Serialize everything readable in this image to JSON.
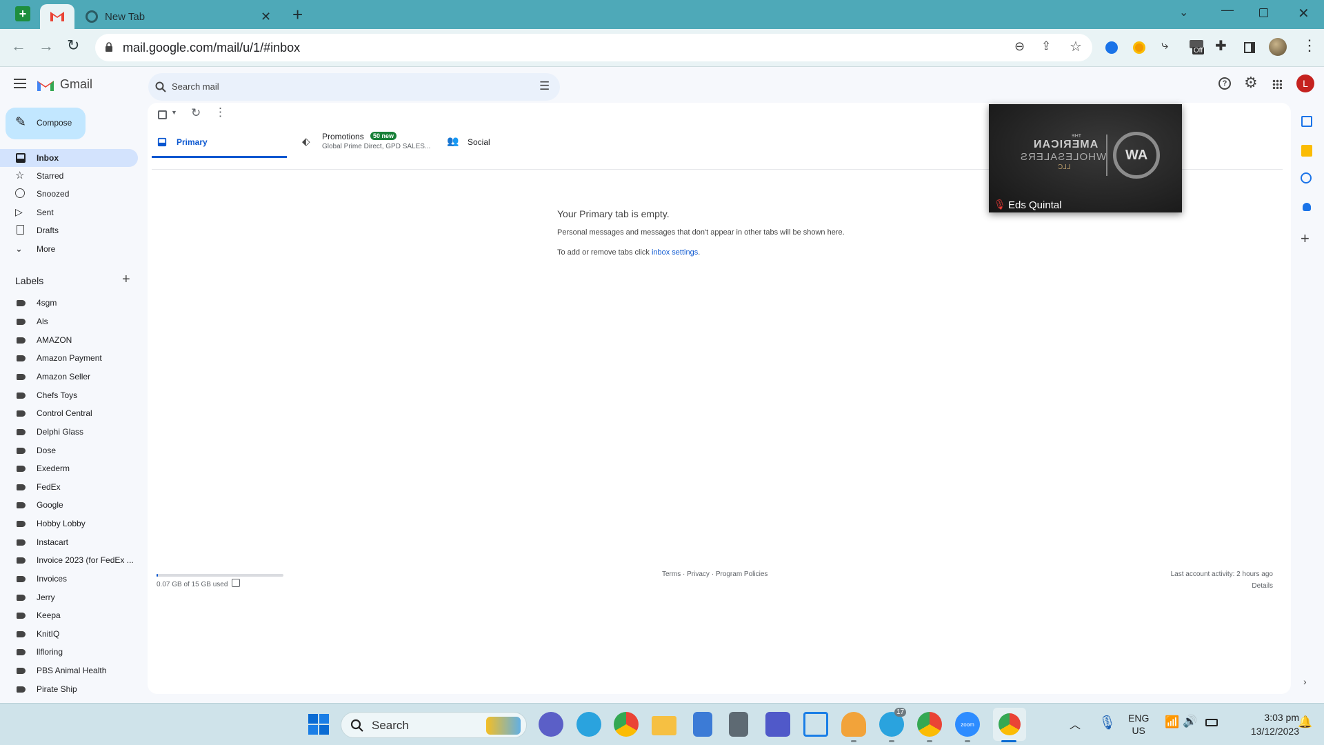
{
  "browser": {
    "tabs": [
      {
        "label": ""
      },
      {
        "label": "New Tab"
      }
    ],
    "url": "mail.google.com/mail/u/1/#inbox",
    "ext_badge": "Off"
  },
  "gmail": {
    "brand": "Gmail",
    "search_placeholder": "Search mail",
    "account_initial": "L",
    "compose": "Compose",
    "nav": [
      {
        "label": "Inbox",
        "icon": "inbox-icon"
      },
      {
        "label": "Starred",
        "icon": "star-icon"
      },
      {
        "label": "Snoozed",
        "icon": "clock-icon"
      },
      {
        "label": "Sent",
        "icon": "send-icon"
      },
      {
        "label": "Drafts",
        "icon": "draft-icon"
      },
      {
        "label": "More",
        "icon": "chevron-down-icon"
      }
    ],
    "labels_heading": "Labels",
    "labels": [
      "4sgm",
      "Als",
      "AMAZON",
      "Amazon Payment",
      "Amazon Seller",
      "Chefs Toys",
      "Control Central",
      "Delphi Glass",
      "Dose",
      "Exederm",
      "FedEx",
      "Google",
      "Hobby Lobby",
      "Instacart",
      "Invoice 2023 (for FedEx ...",
      "Invoices",
      "Jerry",
      "Keepa",
      "KnitIQ",
      "llfloring",
      "PBS Animal Health",
      "Pirate Ship"
    ],
    "tabs": {
      "primary": "Primary",
      "promotions": "Promotions",
      "promotions_badge": "50 new",
      "promotions_sub": "Global Prime Direct, GPD SALES...",
      "social": "Social"
    },
    "empty": {
      "title": "Your Primary tab is empty.",
      "line1": "Personal messages and messages that don't appear in other tabs will be shown here.",
      "line2_prefix": "To add or remove tabs click ",
      "line2_link": "inbox settings",
      "line2_suffix": "."
    },
    "footer": {
      "storage": "0.07 GB of 15 GB used",
      "storage_fraction": 0.005,
      "terms": "Terms",
      "sep": " · ",
      "privacy": "Privacy",
      "policies": "Program Policies",
      "activity": "Last account activity: 2 hours ago",
      "details": "Details"
    },
    "video_overlay": {
      "name": "Eds Quintal",
      "logo_line1": "THE",
      "logo_line2": "AMERICAN",
      "logo_line3": "WHOLESALERS",
      "logo_line4": "LLC",
      "monogram": "AW"
    }
  },
  "taskbar": {
    "search": "Search",
    "lang1": "ENG",
    "lang2": "US",
    "time": "3:03 pm",
    "date": "13/12/2023",
    "telegram_badge": "17"
  },
  "colors": {
    "gmail_red": "#ea4335",
    "accent_blue": "#0b57d0",
    "compose_bg": "#c2e7ff",
    "badge_green": "#188038"
  }
}
